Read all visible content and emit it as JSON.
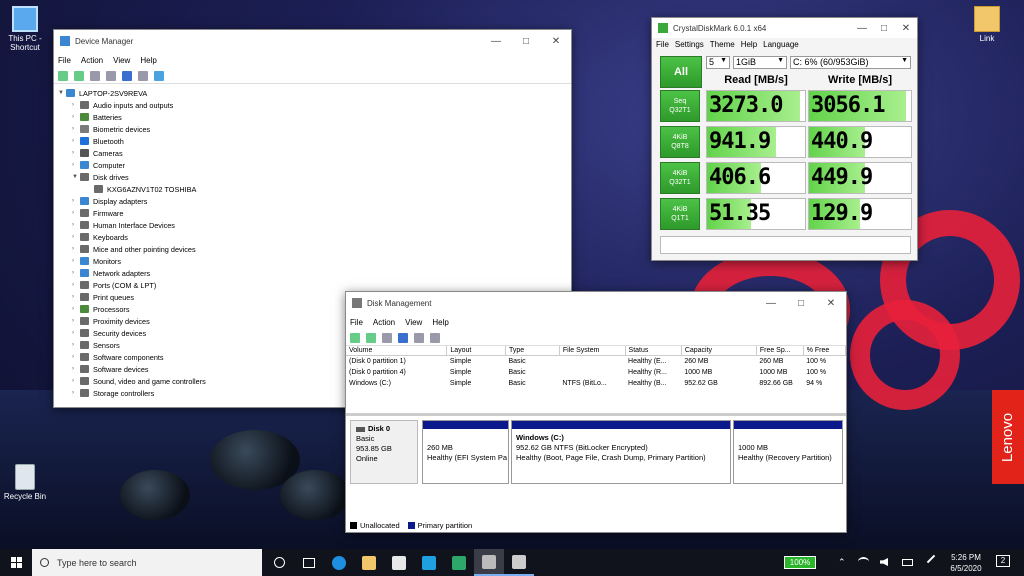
{
  "desktop": {
    "icons": [
      {
        "label": "This PC - Shortcut"
      },
      {
        "label": "Recycle Bin"
      },
      {
        "label": "Link"
      }
    ],
    "brand": "Lenovo"
  },
  "device_manager": {
    "title": "Device Manager",
    "menu": [
      "File",
      "Action",
      "View",
      "Help"
    ],
    "root": "LAPTOP-2SV9REVA",
    "items": [
      {
        "label": "Audio inputs and outputs",
        "color": "#6a6a6a"
      },
      {
        "label": "Batteries",
        "color": "#4a8a3a"
      },
      {
        "label": "Biometric devices",
        "color": "#7a7a7a"
      },
      {
        "label": "Bluetooth",
        "color": "#1e6fd9"
      },
      {
        "label": "Cameras",
        "color": "#555555"
      },
      {
        "label": "Computer",
        "color": "#3a86d0"
      },
      {
        "label": "Disk drives",
        "color": "#6a6a6a",
        "expanded": true
      },
      {
        "label": "KXG6AZNV1T02 TOSHIBA",
        "child": true,
        "color": "#6a6a6a"
      },
      {
        "label": "Display adapters",
        "color": "#3a86d0"
      },
      {
        "label": "Firmware",
        "color": "#6a6a6a"
      },
      {
        "label": "Human Interface Devices",
        "color": "#6a6a6a"
      },
      {
        "label": "Keyboards",
        "color": "#6a6a6a"
      },
      {
        "label": "Mice and other pointing devices",
        "color": "#6a6a6a"
      },
      {
        "label": "Monitors",
        "color": "#3a86d0"
      },
      {
        "label": "Network adapters",
        "color": "#3a86d0"
      },
      {
        "label": "Ports (COM & LPT)",
        "color": "#6a6a6a"
      },
      {
        "label": "Print queues",
        "color": "#6a6a6a"
      },
      {
        "label": "Processors",
        "color": "#4a8a3a"
      },
      {
        "label": "Proximity devices",
        "color": "#6a6a6a"
      },
      {
        "label": "Security devices",
        "color": "#6a6a6a"
      },
      {
        "label": "Sensors",
        "color": "#6a6a6a"
      },
      {
        "label": "Software components",
        "color": "#6a6a6a"
      },
      {
        "label": "Software devices",
        "color": "#6a6a6a"
      },
      {
        "label": "Sound, video and game controllers",
        "color": "#6a6a6a"
      },
      {
        "label": "Storage controllers",
        "color": "#6a6a6a"
      }
    ]
  },
  "crystaldiskmark": {
    "title": "CrystalDiskMark 6.0.1 x64",
    "menu": [
      "File",
      "Settings",
      "Theme",
      "Help",
      "Language"
    ],
    "all_label": "All",
    "count": "5",
    "size": "1GiB",
    "drive": "C: 6% (60/953GiB)",
    "read_header": "Read [MB/s]",
    "write_header": "Write [MB/s]",
    "rows": [
      {
        "label1": "Seq",
        "label2": "Q32T1",
        "read": "3273.0",
        "write": "3056.1",
        "read_fill": 0.95,
        "write_fill": 0.95
      },
      {
        "label1": "4KiB",
        "label2": "Q8T8",
        "read": "941.9",
        "write": "440.9",
        "read_fill": 0.7,
        "write_fill": 0.55
      },
      {
        "label1": "4KiB",
        "label2": "Q32T1",
        "read": "406.6",
        "write": "449.9",
        "read_fill": 0.55,
        "write_fill": 0.55
      },
      {
        "label1": "4KiB",
        "label2": "Q1T1",
        "read": "51.35",
        "write": "129.9",
        "read_fill": 0.45,
        "write_fill": 0.5
      }
    ]
  },
  "disk_management": {
    "title": "Disk Management",
    "menu": [
      "File",
      "Action",
      "View",
      "Help"
    ],
    "columns": [
      "Volume",
      "Layout",
      "Type",
      "File System",
      "Status",
      "Capacity",
      "Free Sp...",
      "% Free"
    ],
    "rows": [
      [
        "(Disk 0 partition 1)",
        "Simple",
        "Basic",
        "",
        "Healthy (E...",
        "260 MB",
        "260 MB",
        "100 %"
      ],
      [
        "(Disk 0 partition 4)",
        "Simple",
        "Basic",
        "",
        "Healthy (R...",
        "1000 MB",
        "1000 MB",
        "100 %"
      ],
      [
        "Windows (C:)",
        "Simple",
        "Basic",
        "NTFS (BitLo...",
        "Healthy (B...",
        "952.62 GB",
        "892.66 GB",
        "94 %"
      ]
    ],
    "disk": {
      "name": "Disk 0",
      "type": "Basic",
      "size": "953.85 GB",
      "status": "Online"
    },
    "partitions": [
      {
        "title": "",
        "size": "260 MB",
        "status": "Healthy (EFI System Pa"
      },
      {
        "title": "Windows  (C:)",
        "size": "952.62 GB NTFS (BitLocker Encrypted)",
        "status": "Healthy (Boot, Page File, Crash Dump, Primary Partition)"
      },
      {
        "title": "",
        "size": "1000 MB",
        "status": "Healthy (Recovery Partition)"
      }
    ],
    "legend": [
      "Unallocated",
      "Primary partition"
    ]
  },
  "taskbar": {
    "search_placeholder": "Type here to search",
    "battery": "100%",
    "time": "5:26 PM",
    "date": "6/5/2020",
    "notifications": "2"
  }
}
